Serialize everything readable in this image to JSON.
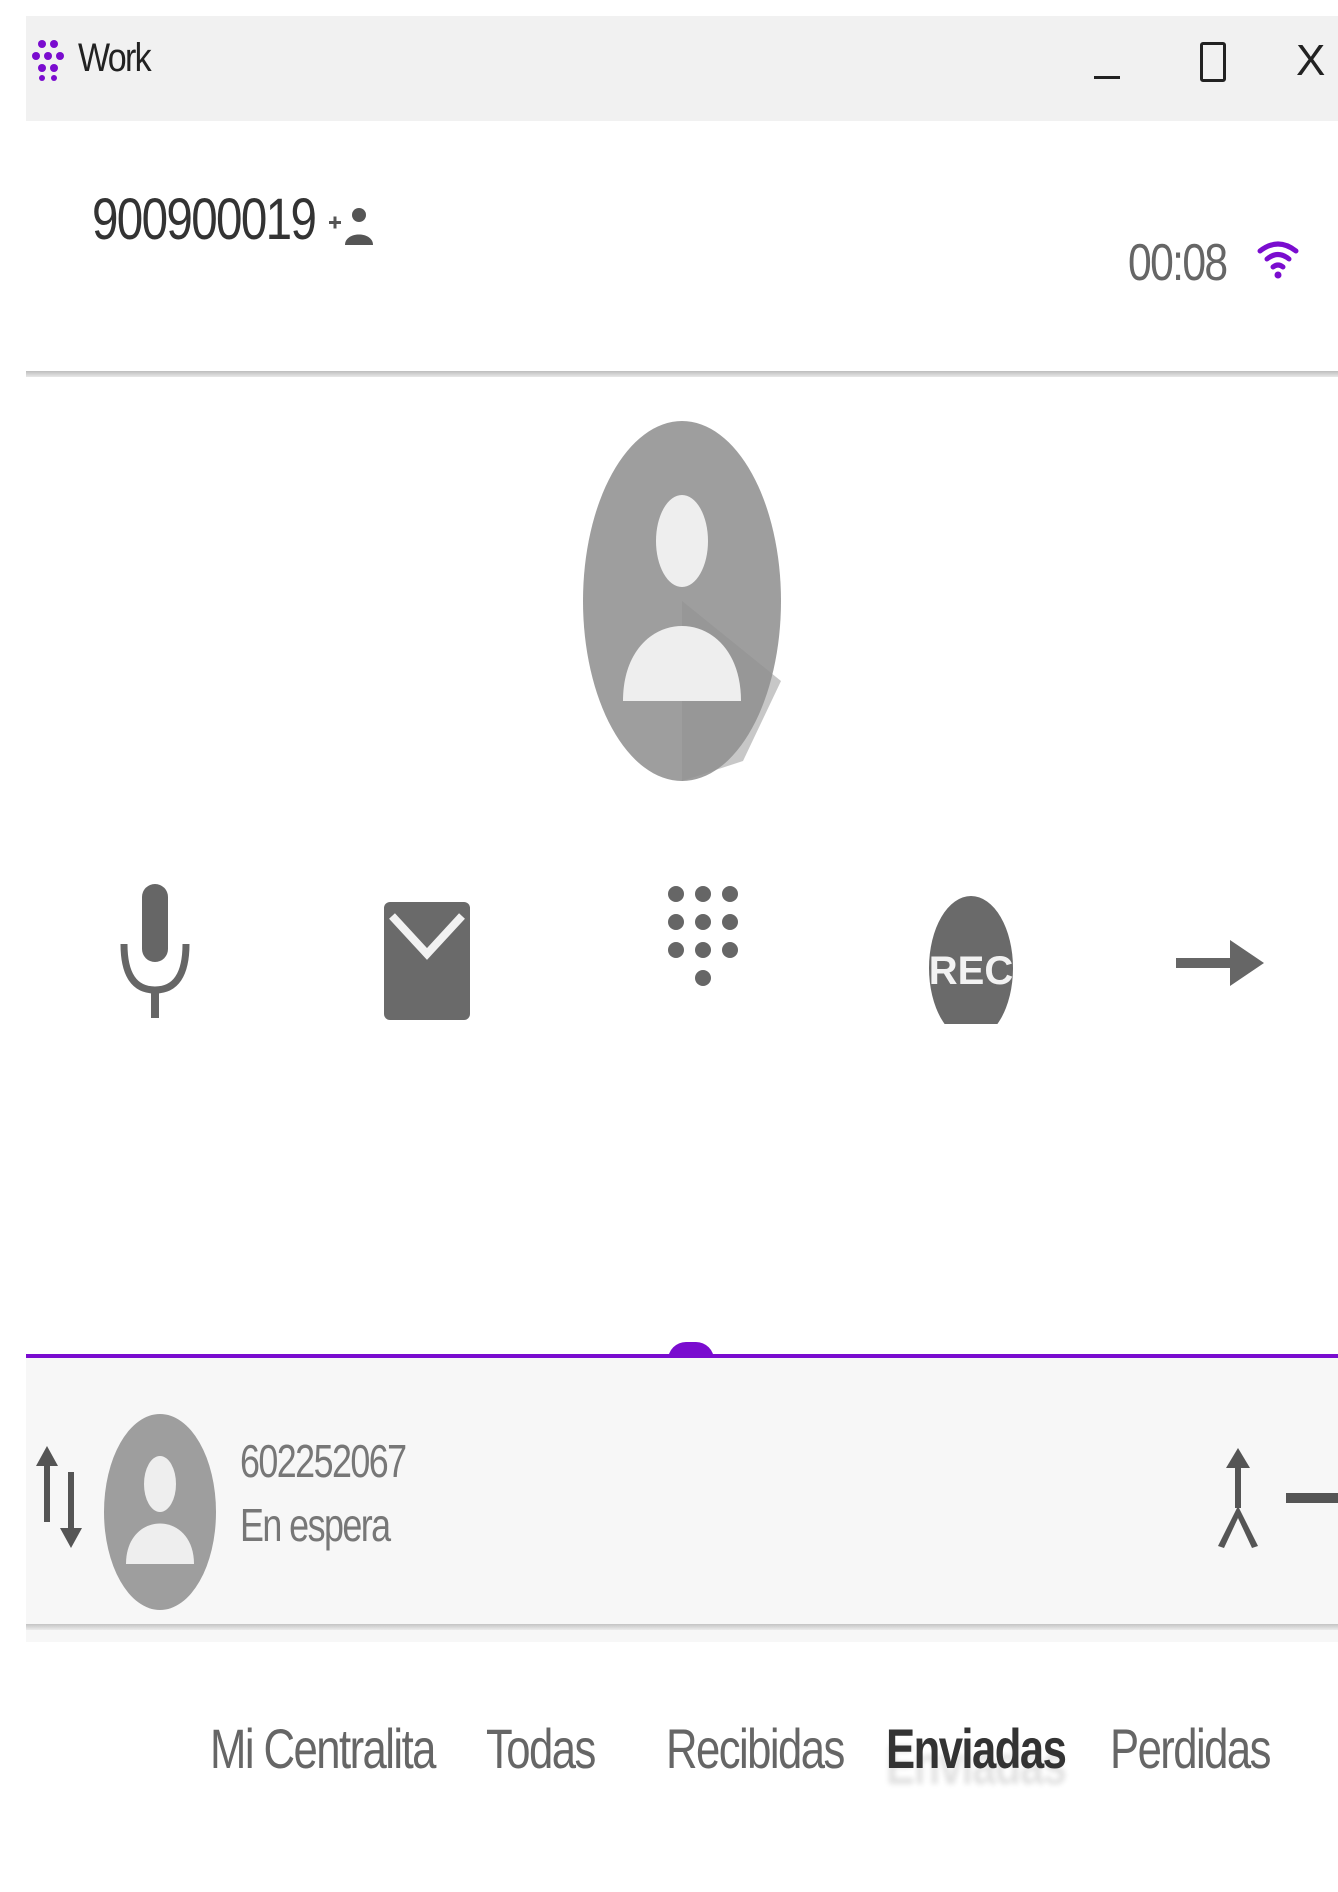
{
  "window": {
    "title": "Work",
    "minimize": "–",
    "maximize": "□",
    "close": "X"
  },
  "call": {
    "number": "900900019",
    "duration": "00:08",
    "signal_color": "#7a0ccf"
  },
  "actions": [
    {
      "icon": "microphone-icon"
    },
    {
      "icon": "mail-icon"
    },
    {
      "icon": "dialpad-icon"
    },
    {
      "icon": "record-icon",
      "label": "REC"
    },
    {
      "icon": "transfer-arrow-icon"
    }
  ],
  "held_call": {
    "number": "602252067",
    "status": "En espera"
  },
  "tabs": [
    {
      "label": "Mi Centralita",
      "active": false
    },
    {
      "label": "Todas",
      "active": false
    },
    {
      "label": "Recibidas",
      "active": false
    },
    {
      "label": "Enviadas",
      "active": true
    },
    {
      "label": "Perdidas",
      "active": false
    }
  ],
  "colors": {
    "accent": "#7a0ccf",
    "icon_gray": "#666666",
    "avatar_gray": "#9e9e9e"
  }
}
